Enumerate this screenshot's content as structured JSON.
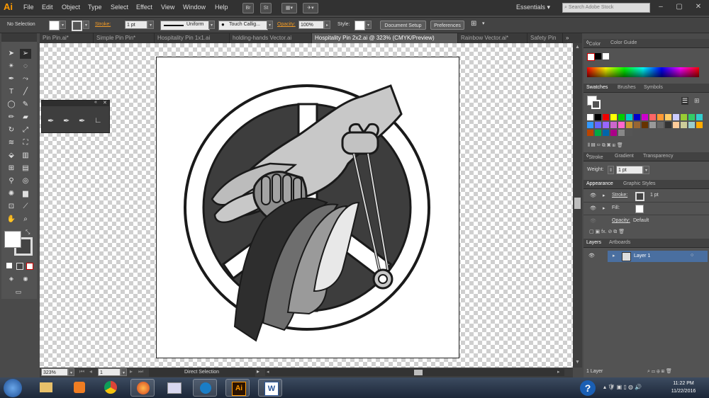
{
  "app": {
    "logo": "Ai"
  },
  "menu": {
    "items": [
      "File",
      "Edit",
      "Object",
      "Type",
      "Select",
      "Effect",
      "View",
      "Window",
      "Help"
    ],
    "bridge": "Br",
    "stock": "St",
    "workspace": "Essentials",
    "search_placeholder": "Search Adobe Stock"
  },
  "control": {
    "selection": "No Selection",
    "stroke_label": "Stroke:",
    "stroke_weight": "1 pt",
    "profile": "Uniform",
    "brush": "Touch Callig...",
    "opacity_label": "Opacity:",
    "opacity": "100%",
    "style_label": "Style:",
    "doc_setup": "Document Setup",
    "preferences": "Preferences"
  },
  "tabs": [
    {
      "label": "Pin Pin.ai*",
      "active": false
    },
    {
      "label": "Simple Pin Pin*",
      "active": false
    },
    {
      "label": "Hospitality Pin 1x1.ai",
      "active": false
    },
    {
      "label": "holding-hands Vector.ai",
      "active": false
    },
    {
      "label": "Hospitality Pin 2x2.ai @ 323% (CMYK/Preview)",
      "active": true
    },
    {
      "label": "Rainbow Vector.ai*",
      "active": false
    },
    {
      "label": "Safety Pin",
      "active": false
    }
  ],
  "status": {
    "zoom": "323%",
    "artboard": "1",
    "tool": "Direct Selection"
  },
  "panels": {
    "color": {
      "tabs": [
        "Color",
        "Color Guide"
      ]
    },
    "swatches": {
      "tabs": [
        "Swatches",
        "Brushes",
        "Symbols"
      ]
    },
    "stroke": {
      "tabs": [
        "Stroke",
        "Gradient",
        "Transparency"
      ],
      "weight_label": "Weight:",
      "weight": "1 pt"
    },
    "appearance": {
      "tabs": [
        "Appearance",
        "Graphic Styles"
      ],
      "stroke_label": "Stroke:",
      "stroke_value": "1 pt",
      "fill_label": "Fill:",
      "opacity_label": "Opacity:",
      "opacity_value": "Default"
    },
    "layers": {
      "tabs": [
        "Layers",
        "Artboards"
      ],
      "layer_name": "Layer 1",
      "count": "1 Layer"
    }
  },
  "taskbar": {
    "time": "11:22 PM",
    "date": "11/22/2016",
    "ai_label": "Ai",
    "word_label": "W"
  },
  "colors": {
    "accent": "#f29b26",
    "layer_highlight": "#4a6fa0"
  }
}
